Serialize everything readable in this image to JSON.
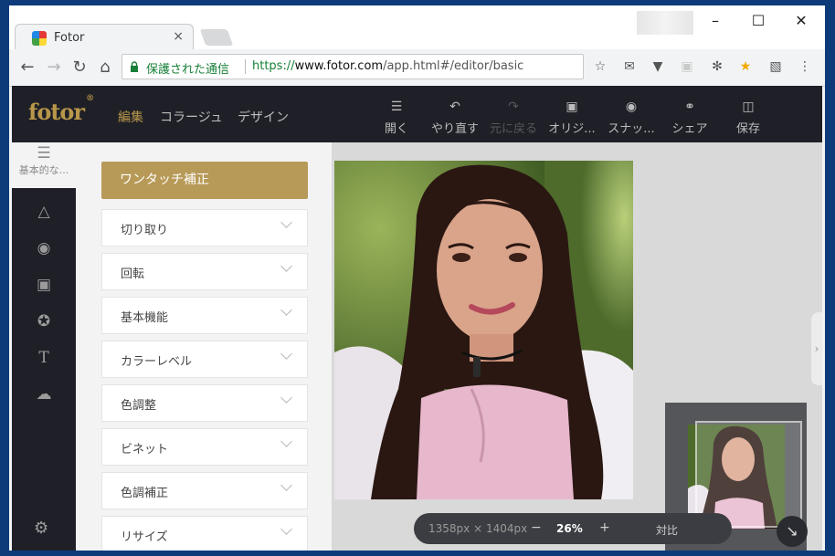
{
  "browser": {
    "tab_title": "Fotor",
    "tab_close": "×",
    "secure_label": "保護された通信",
    "url_scheme": "https://",
    "url_host": "www.fotor.com",
    "url_path": "/app.html#/editor/basic"
  },
  "app": {
    "logo": "fotor",
    "logo_mark": "®",
    "menu": [
      "編集",
      "コラージュ",
      "デザイン"
    ],
    "toolbar": {
      "open": "開く",
      "undo": "やり直す",
      "redo": "元に戻る",
      "original": "オリジ...",
      "snapshot": "スナッ...",
      "share": "シェア",
      "save": "保存"
    },
    "sidebar_active_label": "基本的な...",
    "panel": {
      "one_touch": "ワンタッチ補正",
      "sections": [
        "切り取り",
        "回転",
        "基本機能",
        "カラーレベル",
        "色調整",
        "ビネット",
        "色調補正",
        "リサイズ"
      ]
    },
    "zoom": {
      "dimensions": "1358px × 1404px",
      "minus": "−",
      "percent": "26%",
      "plus": "+",
      "compare": "対比"
    }
  },
  "colors": {
    "accent": "#b89a58",
    "header_bg": "#1f2027",
    "secure_green": "#188038"
  }
}
